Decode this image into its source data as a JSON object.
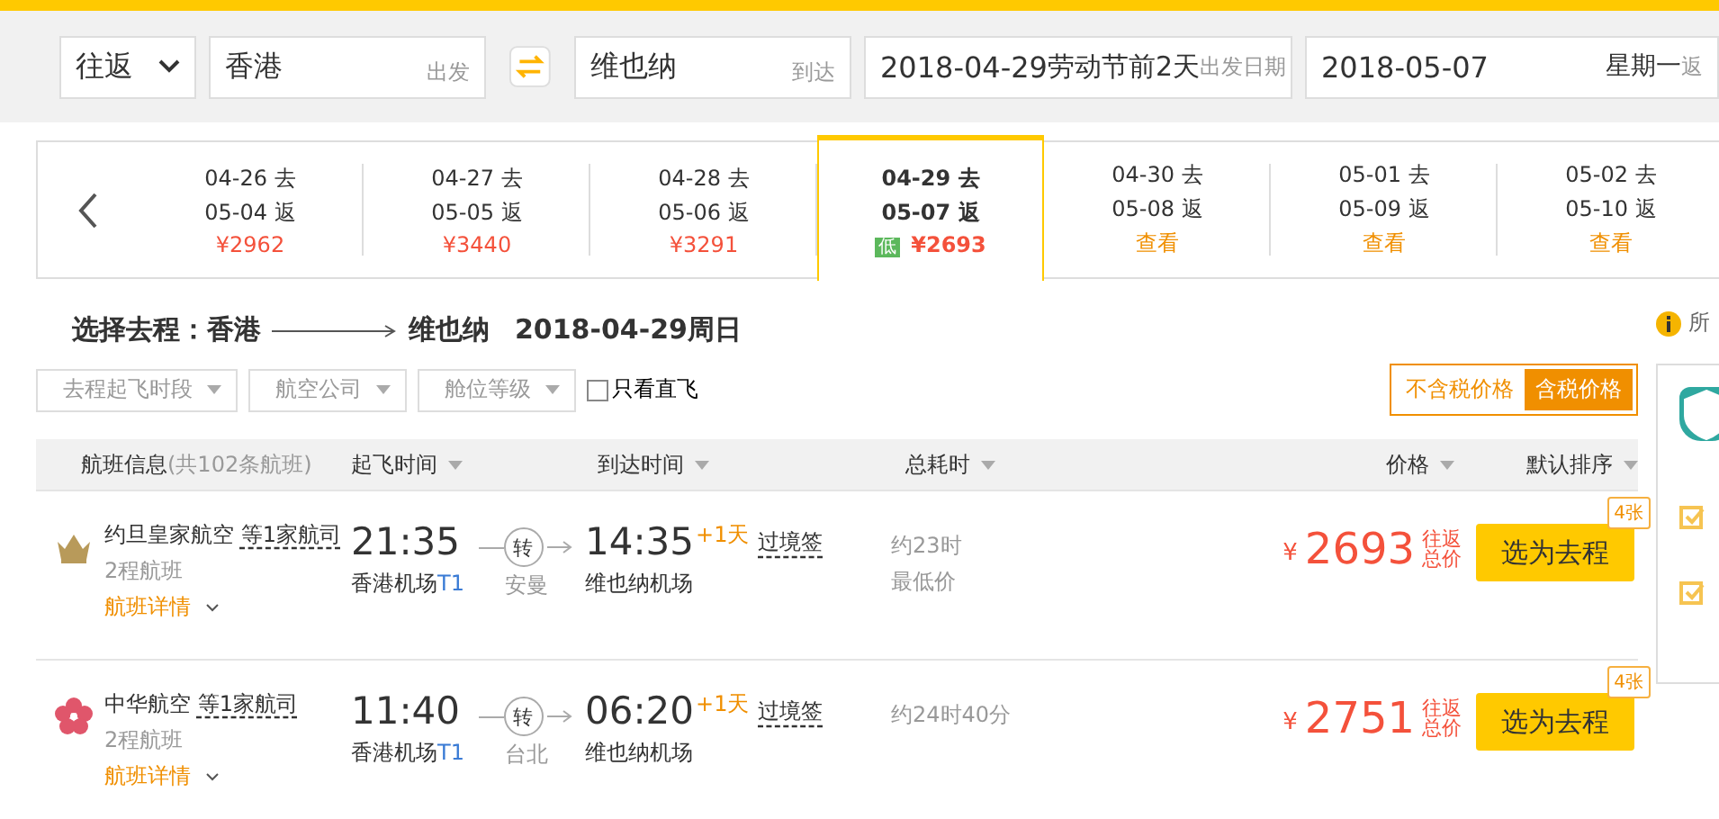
{
  "search": {
    "trip_type": "往返",
    "from": {
      "value": "香港",
      "label": "出发"
    },
    "to": {
      "value": "维也纳",
      "label": "到达"
    },
    "depart": {
      "value": "2018-04-29",
      "note": "劳动节前2天",
      "label": "出发日期"
    },
    "return": {
      "value": "2018-05-07",
      "weekday": "星期一",
      "label": "返"
    }
  },
  "date_strip": [
    {
      "go": "04-26 去",
      "back": "05-04 返",
      "kind": "price",
      "price": "¥2962",
      "selected": false
    },
    {
      "go": "04-27 去",
      "back": "05-05 返",
      "kind": "price",
      "price": "¥3440",
      "selected": false
    },
    {
      "go": "04-28 去",
      "back": "05-06 返",
      "kind": "price",
      "price": "¥3291",
      "selected": false
    },
    {
      "go": "04-29 去",
      "back": "05-07 返",
      "kind": "price",
      "price": "¥2693",
      "badge": "低",
      "selected": true
    },
    {
      "go": "04-30 去",
      "back": "05-08 返",
      "kind": "view",
      "price": "查看",
      "selected": false
    },
    {
      "go": "05-01 去",
      "back": "05-09 返",
      "kind": "view",
      "price": "查看",
      "selected": false
    },
    {
      "go": "05-02 去",
      "back": "05-10 返",
      "kind": "view",
      "price": "查看",
      "selected": false
    }
  ],
  "heading": {
    "label": "选择去程：香港",
    "to": "维也纳",
    "date": "2018-04-29周日"
  },
  "filters": {
    "dropdowns": [
      "去程起飞时段",
      "航空公司",
      "舱位等级"
    ],
    "direct_only": {
      "label": "只看直飞",
      "checked": false
    },
    "tax_toggle": [
      {
        "label": "不含税价格",
        "selected": false
      },
      {
        "label": "含税价格",
        "selected": true
      }
    ]
  },
  "columns": [
    {
      "label": "航班信息",
      "count": "(共102条航班)"
    },
    {
      "label": "起飞时间"
    },
    {
      "label": "到达时间"
    },
    {
      "label": "总耗时"
    },
    {
      "label": "价格"
    },
    {
      "label": "默认排序"
    }
  ],
  "flights": [
    {
      "kind": "crown",
      "airline": "约旦皇家航空",
      "more": "等1家航司",
      "legs": "2程航班",
      "details": "航班详情",
      "dep_time": "21:35",
      "dep_airport": "香港机场",
      "terminal": "T1",
      "transfer": "转",
      "via": "安曼",
      "arr_time": "14:35",
      "day_offset": "+1天",
      "arr_airport": "维也纳机场",
      "visa": "过境签",
      "duration": "约23时",
      "tag": "最低价",
      "currency": "¥",
      "price": "2693",
      "price_note": [
        "往返",
        "总价"
      ],
      "button": "选为去程",
      "tickets": "4张"
    },
    {
      "kind": "blossom",
      "airline": "中华航空",
      "more": "等1家航司",
      "legs": "2程航班",
      "details": "航班详情",
      "dep_time": "11:40",
      "dep_airport": "香港机场",
      "terminal": "T1",
      "transfer": "转",
      "via": "台北",
      "arr_time": "06:20",
      "day_offset": "+1天",
      "arr_airport": "维也纳机场",
      "visa": "过境签",
      "duration": "约24时40分",
      "currency": "¥",
      "price": "2751",
      "price_note": [
        "往返",
        "总价"
      ],
      "button": "选为去程",
      "tickets": "4张"
    }
  ],
  "sidebar": {
    "notice": "所",
    "checks": [
      {
        "checked": true
      },
      {
        "checked": true
      }
    ]
  }
}
